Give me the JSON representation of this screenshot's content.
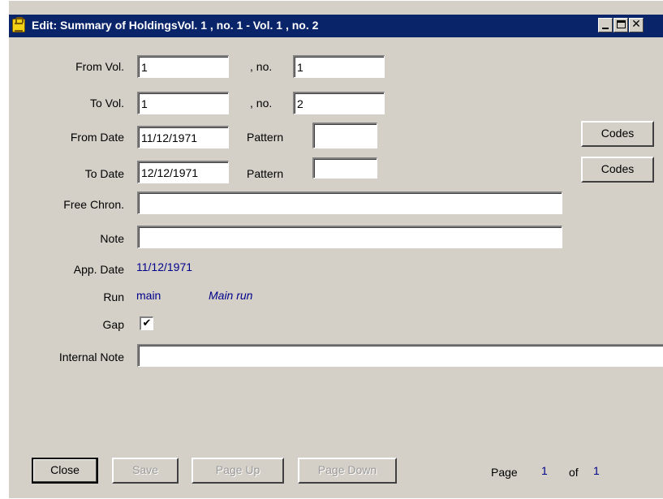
{
  "window": {
    "title": "Edit: Summary of HoldingsVol. 1 , no. 1 - Vol. 1 , no. 2",
    "icon": "app-icon"
  },
  "form": {
    "from_vol": {
      "label": "From Vol.",
      "value": "1"
    },
    "from_no": {
      "label": ", no.",
      "value": "1"
    },
    "to_vol": {
      "label": "To Vol.",
      "value": "1"
    },
    "to_no": {
      "label": ", no.",
      "value": "2"
    },
    "from_date": {
      "label": "From Date",
      "value": "11/12/1971"
    },
    "from_pattern": {
      "label": "Pattern",
      "value": ""
    },
    "to_date": {
      "label": "To Date",
      "value": "12/12/1971"
    },
    "to_pattern": {
      "label": "Pattern",
      "value": ""
    },
    "codes_label": "Codes",
    "free_chron": {
      "label": "Free Chron.",
      "value": ""
    },
    "note": {
      "label": "Note",
      "value": ""
    },
    "app_date": {
      "label": "App. Date",
      "value": "11/12/1971"
    },
    "run": {
      "label": "Run",
      "code": "main",
      "name": "Main run"
    },
    "gap": {
      "label": "Gap",
      "checked": true,
      "mark": "✔"
    },
    "internal_note": {
      "label": "Internal Note",
      "value": ""
    }
  },
  "buttons": {
    "close": "Close",
    "save": "Save",
    "page_up": "Page Up",
    "page_down": "Page Down"
  },
  "pagination": {
    "page_label": "Page",
    "current": "1",
    "of_label": "of",
    "total": "1"
  }
}
